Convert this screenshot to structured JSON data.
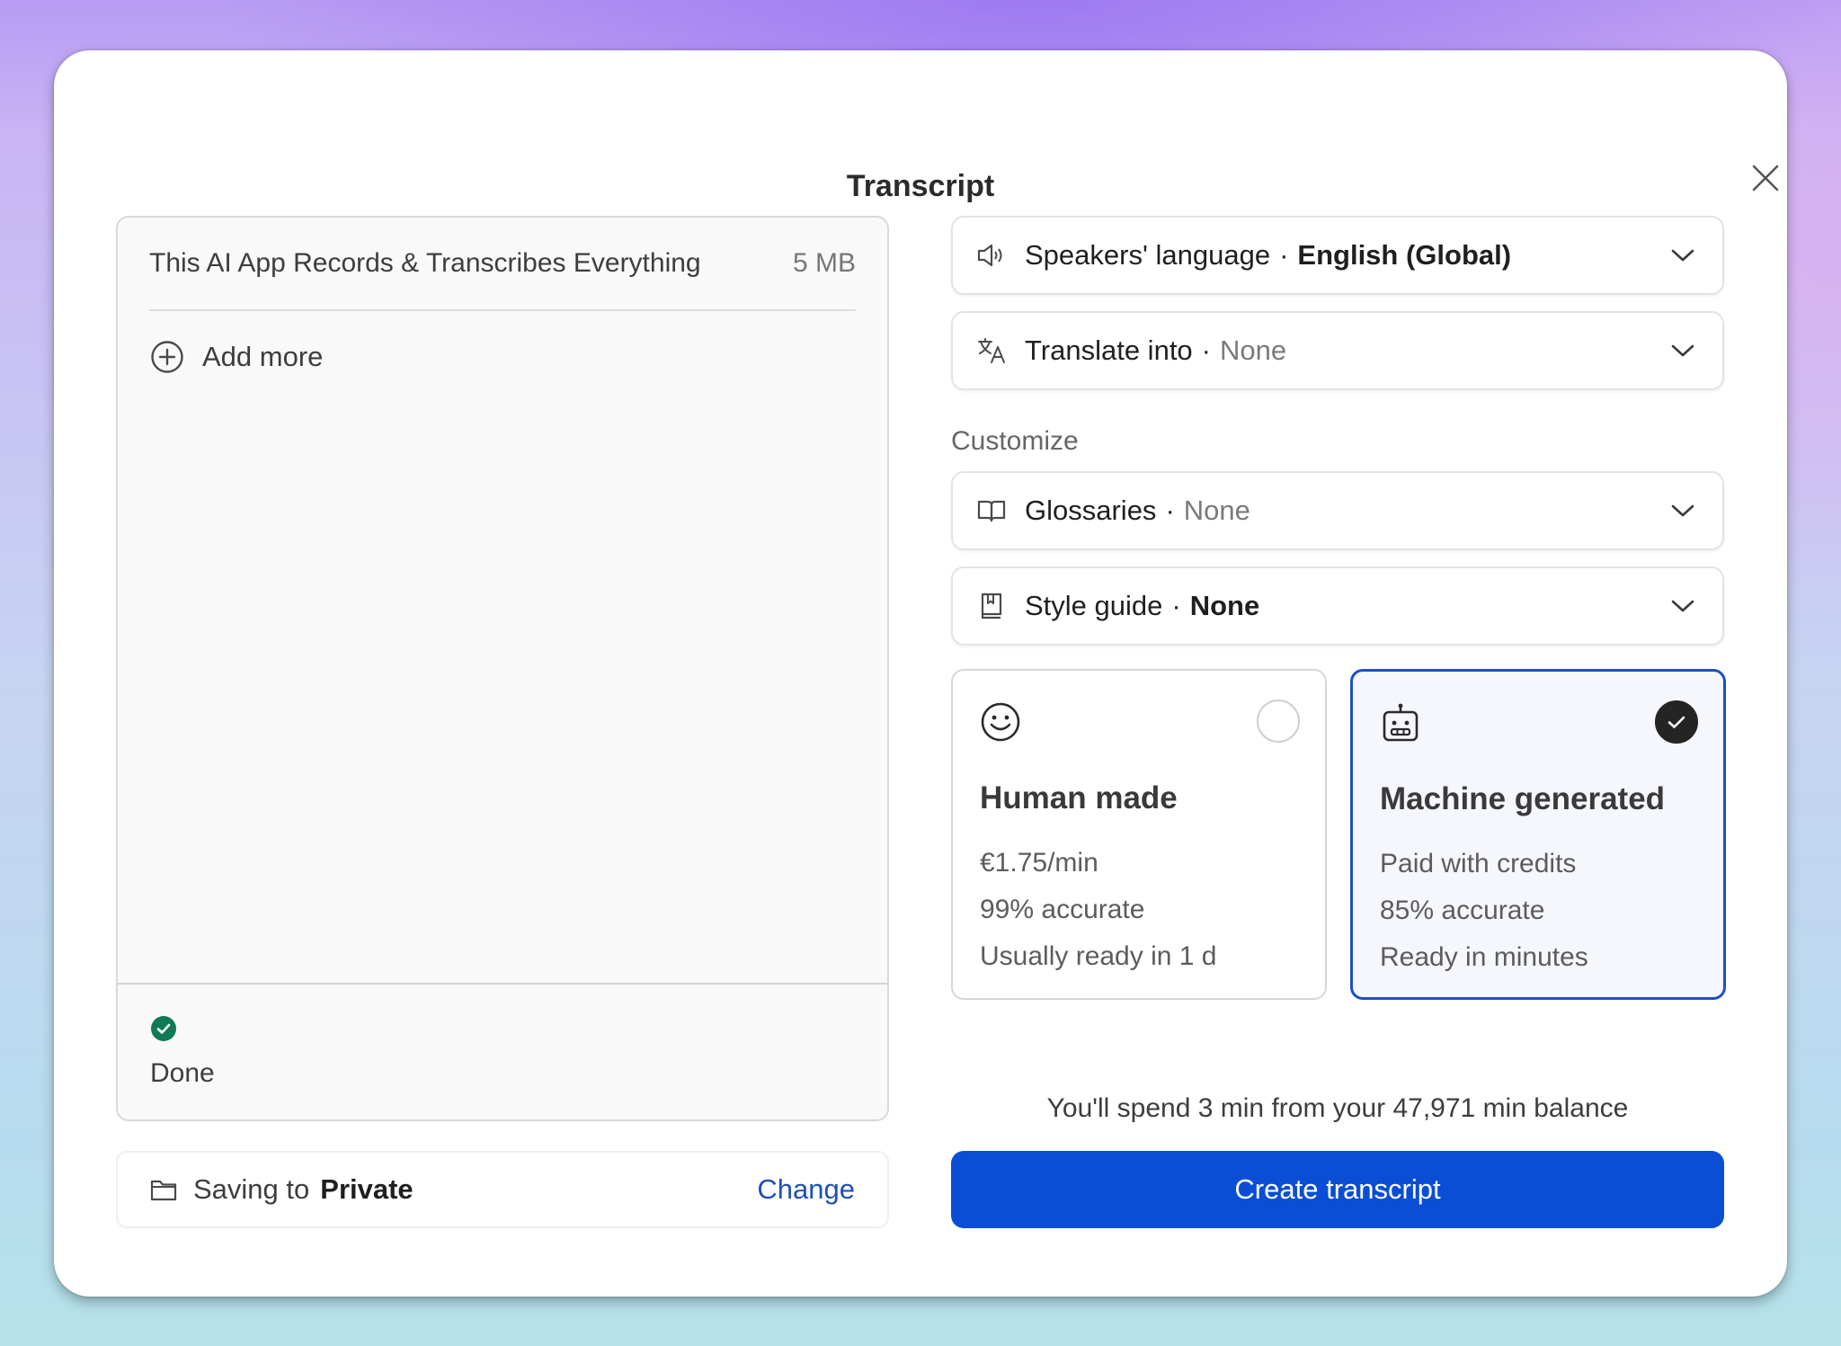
{
  "dialog": {
    "title": "Transcript",
    "close_icon": "close-icon"
  },
  "files": {
    "items": [
      {
        "name": "This AI App Records & Transcribes Everything",
        "size": "5 MB"
      }
    ],
    "add_more_label": "Add more",
    "status_label": "Done",
    "status_color": "#0f7a55"
  },
  "saving": {
    "prefix": "Saving to",
    "destination": "Private",
    "change_label": "Change"
  },
  "language": {
    "label": "Speakers' language",
    "value": "English (Global)"
  },
  "translate": {
    "label": "Translate into",
    "value": "None"
  },
  "customize": {
    "heading": "Customize",
    "glossaries": {
      "label": "Glossaries",
      "value": "None"
    },
    "style_guide": {
      "label": "Style guide",
      "value": "None"
    }
  },
  "options": {
    "human": {
      "title": "Human made",
      "price": "€1.75/min",
      "accuracy": "99% accurate",
      "turnaround": "Usually ready in 1 d",
      "selected": false
    },
    "machine": {
      "title": "Machine generated",
      "price": "Paid with credits",
      "accuracy": "85% accurate",
      "turnaround": "Ready in minutes",
      "selected": true
    }
  },
  "footer": {
    "balance_text": "You'll spend 3 min from your 47,971 min balance",
    "create_label": "Create transcript",
    "accent_color": "#0a4ed6"
  }
}
